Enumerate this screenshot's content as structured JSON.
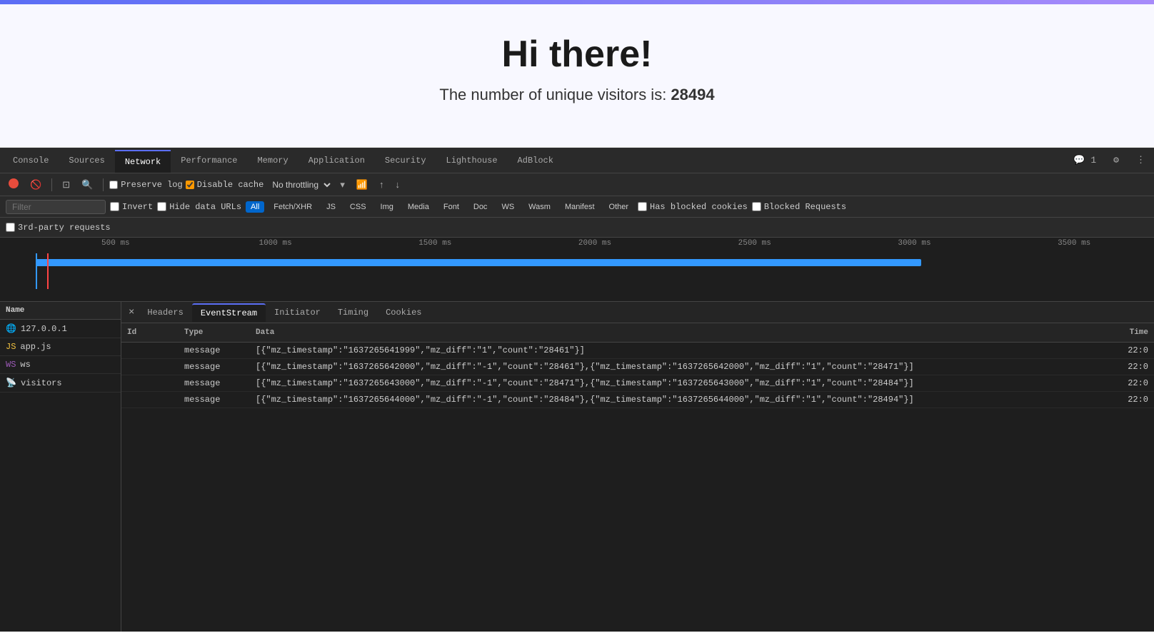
{
  "browser": {
    "top_bar_color": "#6366f1"
  },
  "page": {
    "title": "Hi there!",
    "subtitle_prefix": "The number of unique visitors is: ",
    "visitor_count": "28494"
  },
  "devtools": {
    "tabs": [
      {
        "label": "Console",
        "active": false
      },
      {
        "label": "Sources",
        "active": false
      },
      {
        "label": "Network",
        "active": true
      },
      {
        "label": "Performance",
        "active": false
      },
      {
        "label": "Memory",
        "active": false
      },
      {
        "label": "Application",
        "active": false
      },
      {
        "label": "Security",
        "active": false
      },
      {
        "label": "Lighthouse",
        "active": false
      },
      {
        "label": "AdBlock",
        "active": false
      }
    ],
    "toolbar": {
      "preserve_log_label": "Preserve log",
      "disable_cache_label": "Disable cache",
      "throttle_label": "No throttling"
    },
    "filter": {
      "placeholder": "Filter",
      "invert_label": "Invert",
      "hide_data_urls_label": "Hide data URLs",
      "type_buttons": [
        "All",
        "Fetch/XHR",
        "JS",
        "CSS",
        "Img",
        "Media",
        "Font",
        "Doc",
        "WS",
        "Wasm",
        "Manifest",
        "Other"
      ],
      "active_type": "All",
      "has_blocked_cookies_label": "Has blocked cookies",
      "blocked_requests_label": "Blocked Requests"
    },
    "third_party_label": "3rd-party requests",
    "timeline": {
      "ticks": [
        "500 ms",
        "1000 ms",
        "1500 ms",
        "2000 ms",
        "2500 ms",
        "3000 ms",
        "3500 ms"
      ]
    },
    "network_list": {
      "header": "Name",
      "items": [
        {
          "label": "127.0.0.1",
          "icon": "page"
        },
        {
          "label": "app.js",
          "icon": "js"
        },
        {
          "label": "ws",
          "icon": "ws"
        },
        {
          "label": "visitors",
          "icon": "event"
        }
      ]
    },
    "right_panel": {
      "close_label": "×",
      "tabs": [
        {
          "label": "Headers",
          "active": false
        },
        {
          "label": "EventStream",
          "active": true
        },
        {
          "label": "Initiator",
          "active": false
        },
        {
          "label": "Timing",
          "active": false
        },
        {
          "label": "Cookies",
          "active": false
        }
      ],
      "table_headers": {
        "id": "Id",
        "type": "Type",
        "data": "Data",
        "time": "Time"
      },
      "rows": [
        {
          "id": "",
          "type": "message",
          "data": "[{\"mz_timestamp\":\"1637265641999\",\"mz_diff\":\"1\",\"count\":\"28461\"}]",
          "time": "22:0"
        },
        {
          "id": "",
          "type": "message",
          "data": "[{\"mz_timestamp\":\"1637265642000\",\"mz_diff\":\"-1\",\"count\":\"28461\"},{\"mz_timestamp\":\"1637265642000\",\"mz_diff\":\"1\",\"count\":\"28471\"}]",
          "time": "22:0"
        },
        {
          "id": "",
          "type": "message",
          "data": "[{\"mz_timestamp\":\"1637265643000\",\"mz_diff\":\"-1\",\"count\":\"28471\"},{\"mz_timestamp\":\"1637265643000\",\"mz_diff\":\"1\",\"count\":\"28484\"}]",
          "time": "22:0"
        },
        {
          "id": "",
          "type": "message",
          "data": "[{\"mz_timestamp\":\"1637265644000\",\"mz_diff\":\"-1\",\"count\":\"28484\"},{\"mz_timestamp\":\"1637265644000\",\"mz_diff\":\"1\",\"count\":\"28494\"}]",
          "time": "22:0"
        }
      ]
    }
  }
}
